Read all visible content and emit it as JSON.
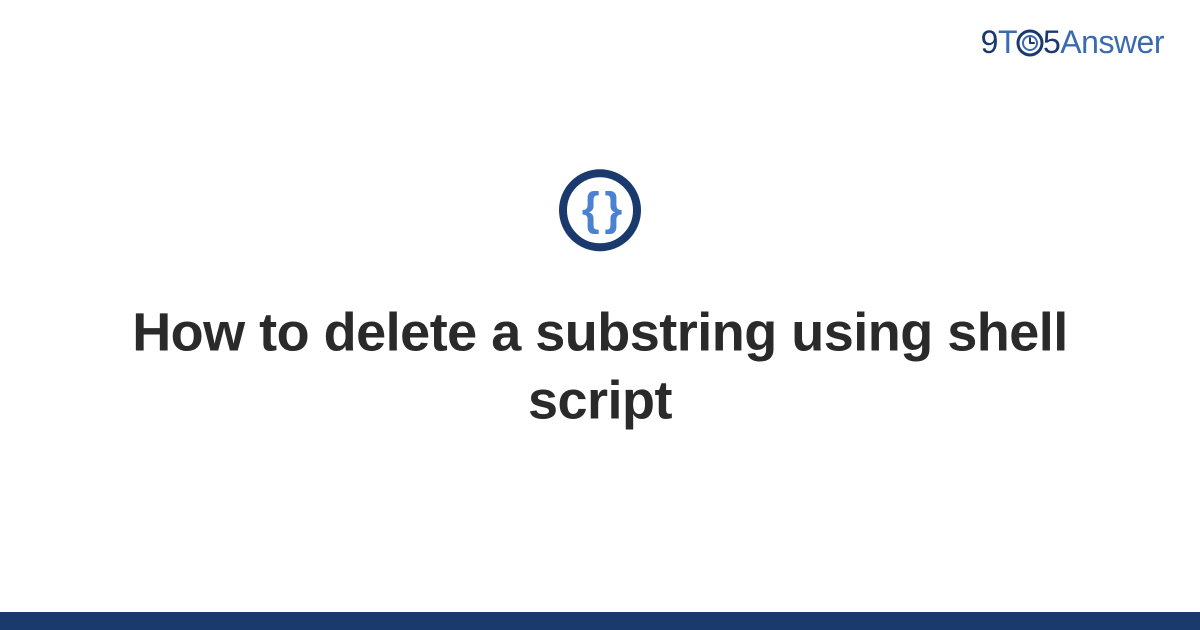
{
  "brand": {
    "nine": "9",
    "t": "T",
    "five": "5",
    "answer": "Answer"
  },
  "icon": {
    "braces": "{ }"
  },
  "title": "How to delete a substring using shell script",
  "colors": {
    "dark_blue": "#1a3a6e",
    "light_blue": "#3a6bb0",
    "brace_blue": "#4a82d1",
    "text_dark": "#2a2a2a"
  }
}
